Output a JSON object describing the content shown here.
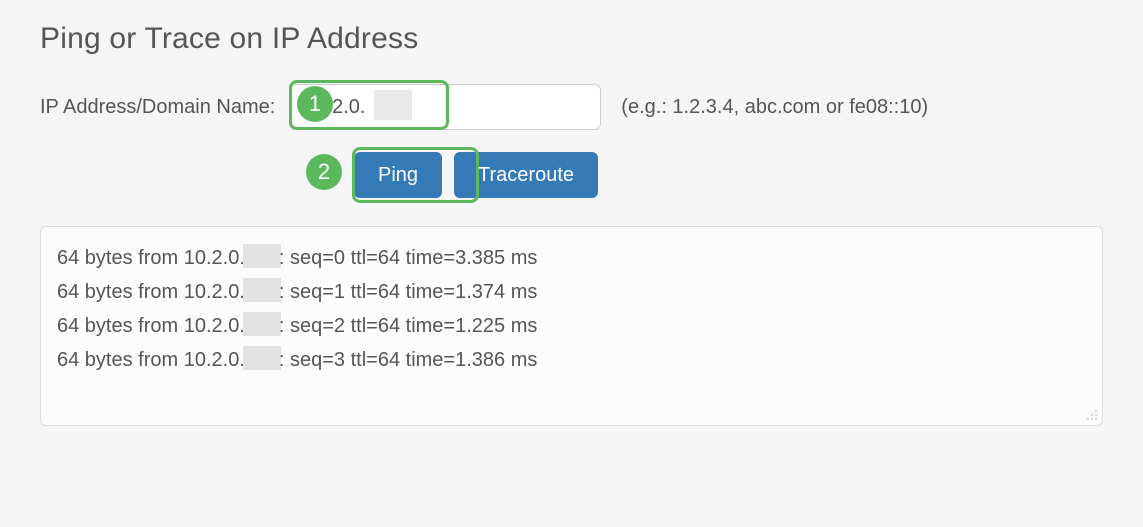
{
  "title": "Ping or Trace on IP Address",
  "field_label": "IP Address/Domain Name:",
  "input": {
    "value": "10.2.0.",
    "placeholder": ""
  },
  "hint": "(e.g.: 1.2.3.4, abc.com or fe08::10)",
  "badges": {
    "one": "1",
    "two": "2"
  },
  "buttons": {
    "ping": "Ping",
    "traceroute": "Traceroute"
  },
  "output": {
    "prefix": "64 bytes from 10.2.0.",
    "lines": [
      {
        "seq": 0,
        "ttl": 64,
        "time_ms": "3.385"
      },
      {
        "seq": 1,
        "ttl": 64,
        "time_ms": "1.374"
      },
      {
        "seq": 2,
        "ttl": 64,
        "time_ms": "1.225"
      },
      {
        "seq": 3,
        "ttl": 64,
        "time_ms": "1.386"
      }
    ]
  }
}
